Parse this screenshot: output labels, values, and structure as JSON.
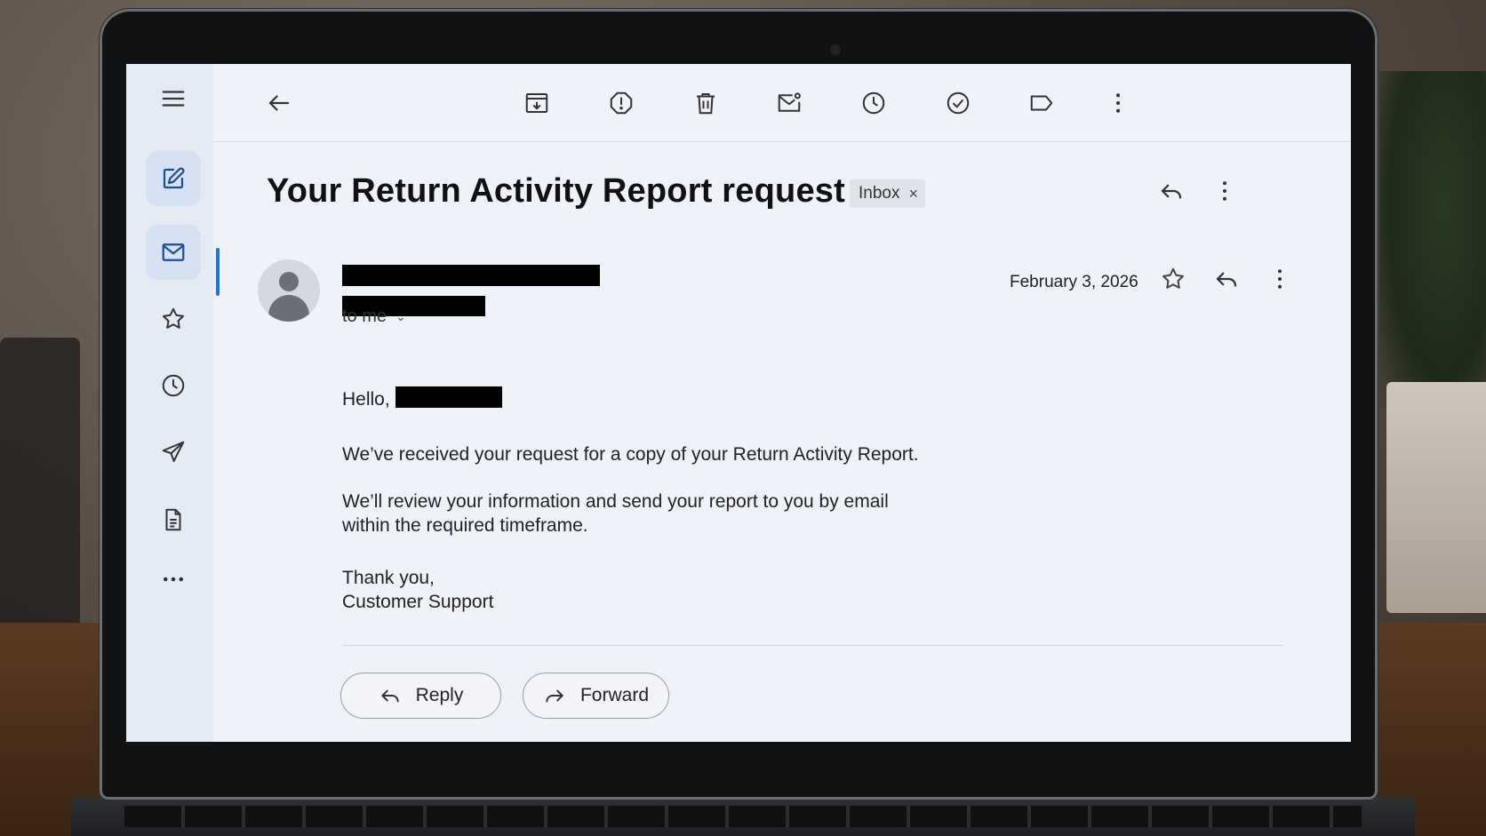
{
  "email": {
    "subject": "Your Return Activity Report request",
    "label_chip": "Inbox",
    "label_chip_close": "×",
    "recipient": "to me",
    "date": "February 3, 2026",
    "greeting": "Hello,",
    "paragraph1": "We’ve received your request for a copy of your Return Activity Report.",
    "paragraph2_line1": "We’ll review your information and send your report to you by email",
    "paragraph2_line2": "within the required timeframe.",
    "signoff_line1": "Thank you,",
    "signoff_line2": "Customer Support"
  },
  "actions": {
    "reply_label": "Reply",
    "forward_label": "Forward"
  },
  "toolbar_icons": [
    "back-arrow-icon",
    "archive-icon",
    "report-spam-icon",
    "delete-icon",
    "mark-unread-icon",
    "snooze-icon",
    "add-task-icon",
    "label-icon",
    "more-vert-icon"
  ],
  "sidebar_icons": [
    "menu-icon",
    "compose-icon",
    "mail-icon",
    "star-icon",
    "clock-icon",
    "send-icon",
    "document-icon",
    "more-horiz-icon"
  ],
  "colors": {
    "accent": "#1a73e8",
    "screen_bg": "#eff2f8",
    "rail_bg": "#e5ebf4",
    "chip_bg": "#dfe3ea"
  }
}
